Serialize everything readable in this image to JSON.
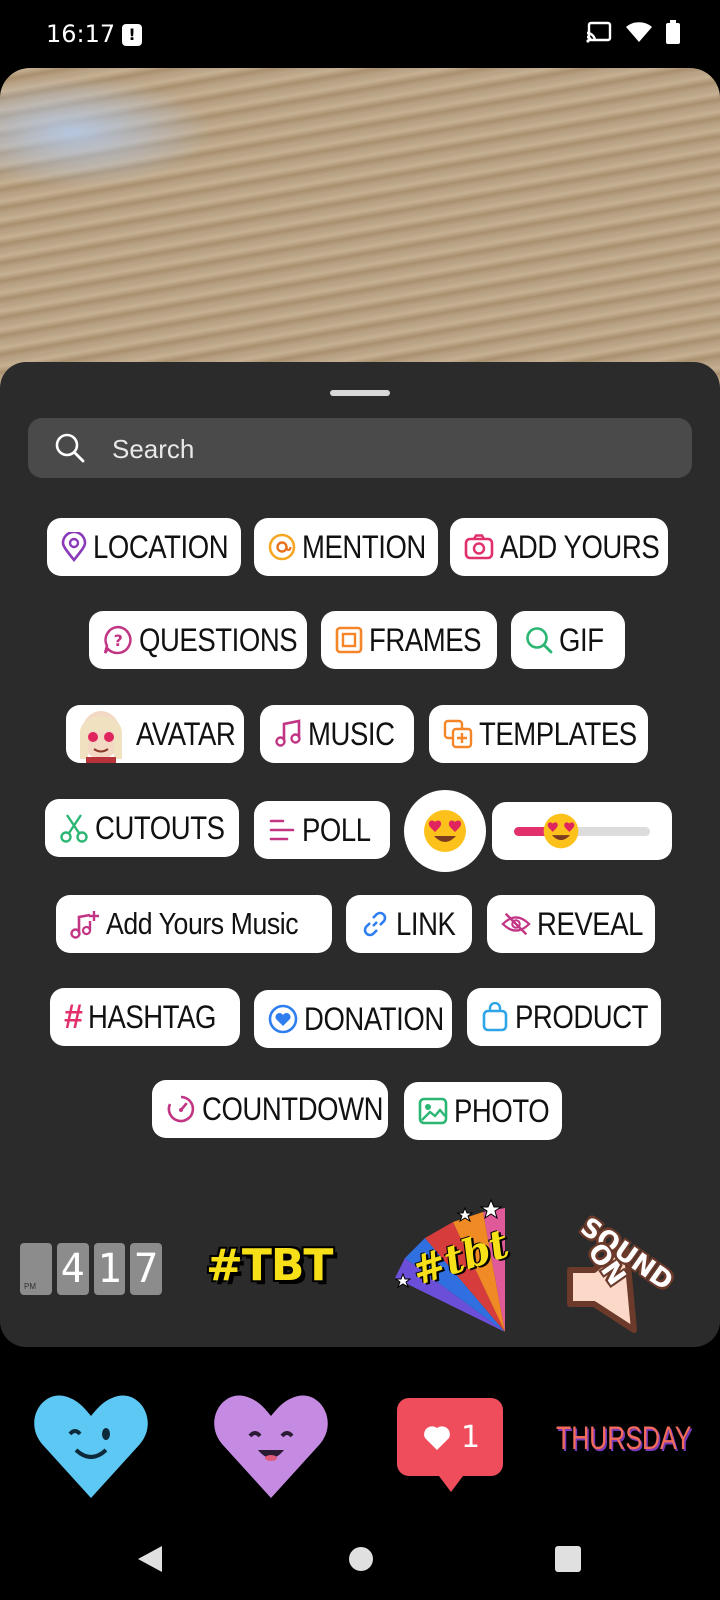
{
  "status_bar": {
    "time": "16:17"
  },
  "search": {
    "placeholder": "Search"
  },
  "stickers": {
    "location": "LOCATION",
    "mention": "MENTION",
    "add_yours": "ADD YOURS",
    "questions": "QUESTIONS",
    "frames": "FRAMES",
    "gif": "GIF",
    "avatar": "AVATAR",
    "music": "MUSIC",
    "templates": "TEMPLATES",
    "cutouts": "CUTOUTS",
    "poll": "POLL",
    "add_yours_music": "Add Yours Music",
    "link": "LINK",
    "reveal": "REVEAL",
    "hashtag": "HASHTAG",
    "donation": "DONATION",
    "product": "PRODUCT",
    "countdown": "COUNTDOWN",
    "photo": "PHOTO"
  },
  "gif_stickers": {
    "clock": [
      "4",
      "1",
      "7"
    ],
    "tbt": "#TBT",
    "tbt_fan": "#tbt",
    "sound_on": [
      "SOUND",
      "ON"
    ]
  },
  "bottom_stickers": {
    "like_count": "1",
    "day": "THURSDAY"
  },
  "colors": {
    "sheet_bg": "#2b2b2b",
    "search_bg": "#4a4a4a",
    "accent_pink": "#e1306c",
    "accent_purple": "#8a3ab9"
  }
}
